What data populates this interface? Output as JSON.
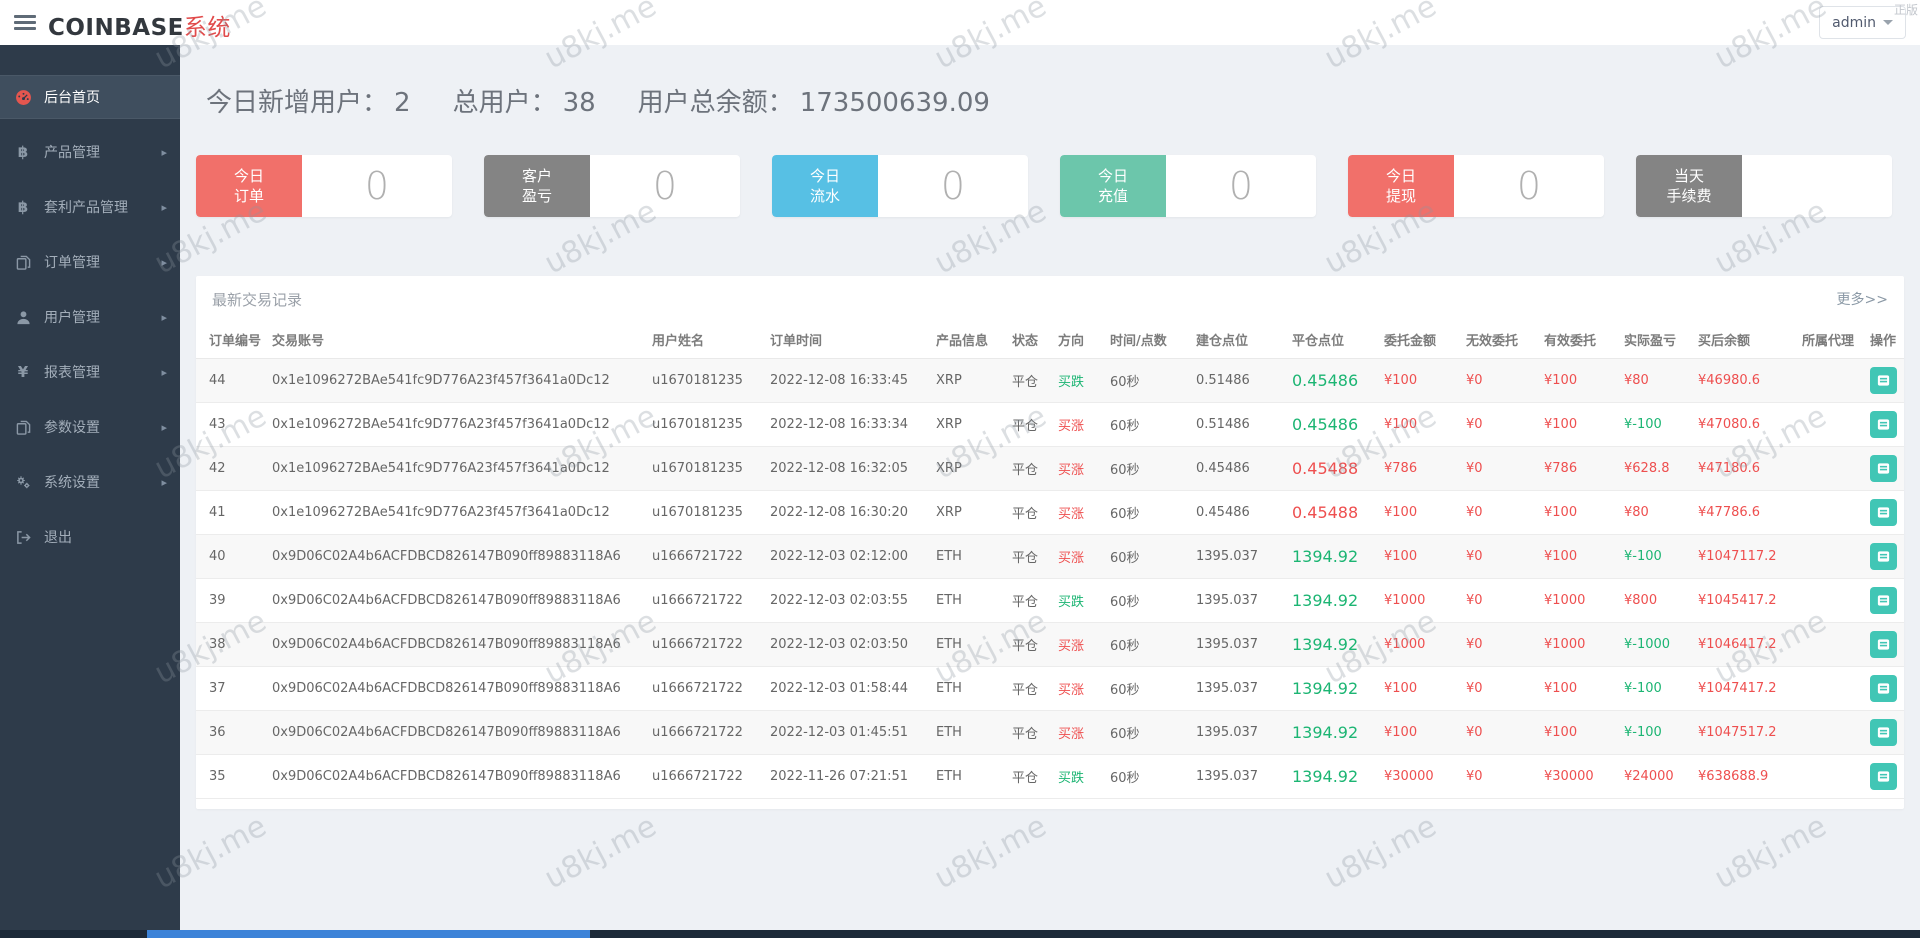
{
  "watermark": {
    "text": "u8kj.me",
    "corner_text": "正版"
  },
  "topbar": {
    "brand_primary": "COINBASE",
    "brand_secondary": "系统",
    "user_menu_label": "admin"
  },
  "sidebar": {
    "items": [
      {
        "label": "后台首页",
        "icon": "dashboard",
        "active": true,
        "has_children": false
      },
      {
        "label": "产品管理",
        "icon": "bitcoin",
        "active": false,
        "has_children": true
      },
      {
        "label": "套利产品管理",
        "icon": "bitcoin",
        "active": false,
        "has_children": true
      },
      {
        "label": "订单管理",
        "icon": "files",
        "active": false,
        "has_children": true
      },
      {
        "label": "用户管理",
        "icon": "user",
        "active": false,
        "has_children": true
      },
      {
        "label": "报表管理",
        "icon": "yen",
        "active": false,
        "has_children": true
      },
      {
        "label": "参数设置",
        "icon": "files",
        "active": false,
        "has_children": true
      },
      {
        "label": "系统设置",
        "icon": "gears",
        "active": false,
        "has_children": true
      },
      {
        "label": "退出",
        "icon": "logout",
        "active": false,
        "has_children": false
      }
    ]
  },
  "overview": {
    "stats": [
      {
        "label": "今日新增用户：",
        "value": "2"
      },
      {
        "label": "总用户：",
        "value": "38"
      },
      {
        "label": "用户总余额：",
        "value": "173500639.09"
      }
    ]
  },
  "cards": [
    {
      "label_lines": [
        "今日",
        "订单"
      ],
      "color": "#f1706a",
      "value": "0"
    },
    {
      "label_lines": [
        "客户",
        "盈亏"
      ],
      "color": "#848484",
      "value": "0"
    },
    {
      "label_lines": [
        "今日",
        "流水"
      ],
      "color": "#57c0e4",
      "value": "0"
    },
    {
      "label_lines": [
        "今日",
        "充值"
      ],
      "color": "#6cc6ab",
      "value": "0"
    },
    {
      "label_lines": [
        "今日",
        "提现"
      ],
      "color": "#f1706a",
      "value": "0"
    },
    {
      "label_lines": [
        "当天",
        "手续费"
      ],
      "color": "#848484",
      "value": ""
    }
  ],
  "panel": {
    "title": "最新交易记录",
    "more_label": "更多>>"
  },
  "table": {
    "columns": [
      "订单编号",
      "交易账号",
      "用户姓名",
      "订单时间",
      "产品信息",
      "状态",
      "方向",
      "时间/点数",
      "建仓点位",
      "平仓点位",
      "委托金额",
      "无效委托",
      "有效委托",
      "实际盈亏",
      "买后余额",
      "所属代理",
      "操作"
    ],
    "rows": [
      {
        "id": "44",
        "account": "0x1e1096272BAe541fc9D776A23f457f3641a0Dc12",
        "username": "u1670181235",
        "time": "2022-12-08 16:33:45",
        "product": "XRP",
        "status": "平仓",
        "direction": "买跌",
        "direction_color": "green",
        "duration": "60秒",
        "open_point": "0.51486",
        "close_point": "0.45486",
        "close_color": "green",
        "amount": "¥100",
        "invalid": "¥0",
        "valid": "¥100",
        "profit": "¥80",
        "profit_color": "red",
        "balance": "¥46980.6",
        "agent": ""
      },
      {
        "id": "43",
        "account": "0x1e1096272BAe541fc9D776A23f457f3641a0Dc12",
        "username": "u1670181235",
        "time": "2022-12-08 16:33:34",
        "product": "XRP",
        "status": "平仓",
        "direction": "买涨",
        "direction_color": "red",
        "duration": "60秒",
        "open_point": "0.51486",
        "close_point": "0.45486",
        "close_color": "green",
        "amount": "¥100",
        "invalid": "¥0",
        "valid": "¥100",
        "profit": "¥-100",
        "profit_color": "green",
        "balance": "¥47080.6",
        "agent": ""
      },
      {
        "id": "42",
        "account": "0x1e1096272BAe541fc9D776A23f457f3641a0Dc12",
        "username": "u1670181235",
        "time": "2022-12-08 16:32:05",
        "product": "XRP",
        "status": "平仓",
        "direction": "买涨",
        "direction_color": "red",
        "duration": "60秒",
        "open_point": "0.45486",
        "close_point": "0.45488",
        "close_color": "red",
        "amount": "¥786",
        "invalid": "¥0",
        "valid": "¥786",
        "profit": "¥628.8",
        "profit_color": "red",
        "balance": "¥47180.6",
        "agent": ""
      },
      {
        "id": "41",
        "account": "0x1e1096272BAe541fc9D776A23f457f3641a0Dc12",
        "username": "u1670181235",
        "time": "2022-12-08 16:30:20",
        "product": "XRP",
        "status": "平仓",
        "direction": "买涨",
        "direction_color": "red",
        "duration": "60秒",
        "open_point": "0.45486",
        "close_point": "0.45488",
        "close_color": "red",
        "amount": "¥100",
        "invalid": "¥0",
        "valid": "¥100",
        "profit": "¥80",
        "profit_color": "red",
        "balance": "¥47786.6",
        "agent": ""
      },
      {
        "id": "40",
        "account": "0x9D06C02A4b6ACFDBCD826147B090ff89883118A6",
        "username": "u1666721722",
        "time": "2022-12-03 02:12:00",
        "product": "ETH",
        "status": "平仓",
        "direction": "买涨",
        "direction_color": "red",
        "duration": "60秒",
        "open_point": "1395.037",
        "close_point": "1394.92",
        "close_color": "green",
        "amount": "¥100",
        "invalid": "¥0",
        "valid": "¥100",
        "profit": "¥-100",
        "profit_color": "green",
        "balance": "¥1047117.2",
        "agent": ""
      },
      {
        "id": "39",
        "account": "0x9D06C02A4b6ACFDBCD826147B090ff89883118A6",
        "username": "u1666721722",
        "time": "2022-12-03 02:03:55",
        "product": "ETH",
        "status": "平仓",
        "direction": "买跌",
        "direction_color": "green",
        "duration": "60秒",
        "open_point": "1395.037",
        "close_point": "1394.92",
        "close_color": "green",
        "amount": "¥1000",
        "invalid": "¥0",
        "valid": "¥1000",
        "profit": "¥800",
        "profit_color": "red",
        "balance": "¥1045417.2",
        "agent": ""
      },
      {
        "id": "38",
        "account": "0x9D06C02A4b6ACFDBCD826147B090ff89883118A6",
        "username": "u1666721722",
        "time": "2022-12-03 02:03:50",
        "product": "ETH",
        "status": "平仓",
        "direction": "买涨",
        "direction_color": "red",
        "duration": "60秒",
        "open_point": "1395.037",
        "close_point": "1394.92",
        "close_color": "green",
        "amount": "¥1000",
        "invalid": "¥0",
        "valid": "¥1000",
        "profit": "¥-1000",
        "profit_color": "green",
        "balance": "¥1046417.2",
        "agent": ""
      },
      {
        "id": "37",
        "account": "0x9D06C02A4b6ACFDBCD826147B090ff89883118A6",
        "username": "u1666721722",
        "time": "2022-12-03 01:58:44",
        "product": "ETH",
        "status": "平仓",
        "direction": "买涨",
        "direction_color": "red",
        "duration": "60秒",
        "open_point": "1395.037",
        "close_point": "1394.92",
        "close_color": "green",
        "amount": "¥100",
        "invalid": "¥0",
        "valid": "¥100",
        "profit": "¥-100",
        "profit_color": "green",
        "balance": "¥1047417.2",
        "agent": ""
      },
      {
        "id": "36",
        "account": "0x9D06C02A4b6ACFDBCD826147B090ff89883118A6",
        "username": "u1666721722",
        "time": "2022-12-03 01:45:51",
        "product": "ETH",
        "status": "平仓",
        "direction": "买涨",
        "direction_color": "red",
        "duration": "60秒",
        "open_point": "1395.037",
        "close_point": "1394.92",
        "close_color": "green",
        "amount": "¥100",
        "invalid": "¥0",
        "valid": "¥100",
        "profit": "¥-100",
        "profit_color": "green",
        "balance": "¥1047517.2",
        "agent": ""
      },
      {
        "id": "35",
        "account": "0x9D06C02A4b6ACFDBCD826147B090ff89883118A6",
        "username": "u1666721722",
        "time": "2022-11-26 07:21:51",
        "product": "ETH",
        "status": "平仓",
        "direction": "买跌",
        "direction_color": "green",
        "duration": "60秒",
        "open_point": "1395.037",
        "close_point": "1394.92",
        "close_color": "green",
        "amount": "¥30000",
        "invalid": "¥0",
        "valid": "¥30000",
        "profit": "¥24000",
        "profit_color": "red",
        "balance": "¥638688.9",
        "agent": ""
      }
    ]
  },
  "colors": {
    "up_red": "#ee4f4f",
    "down_green": "#1cb573",
    "action_teal": "#41c6b5",
    "sidebar_bg": "#2e3b4a",
    "brand_accent": "#e14b4b"
  }
}
